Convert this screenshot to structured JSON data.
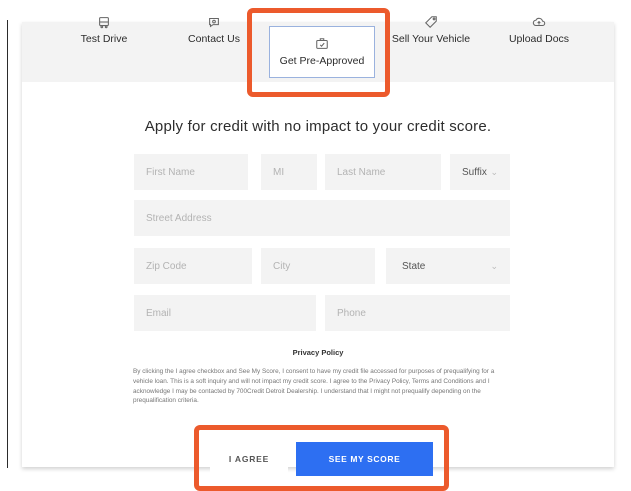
{
  "tabs": [
    {
      "label": "Test Drive",
      "icon": "car-icon"
    },
    {
      "label": "Contact Us",
      "icon": "chat-icon"
    },
    {
      "label": "Get Pre-Approved",
      "icon": "approval-icon",
      "active": true
    },
    {
      "label": "Sell Your Vehicle",
      "icon": "tag-icon"
    },
    {
      "label": "Upload Docs",
      "icon": "upload-cloud-icon"
    }
  ],
  "headline": "Apply for credit with no impact to your credit score.",
  "form": {
    "first_name_placeholder": "First Name",
    "mi_placeholder": "MI",
    "last_name_placeholder": "Last Name",
    "suffix_label": "Suffix",
    "street_placeholder": "Street Address",
    "zip_placeholder": "Zip Code",
    "city_placeholder": "City",
    "state_label": "State",
    "email_placeholder": "Email",
    "phone_placeholder": "Phone"
  },
  "privacy": {
    "title": "Privacy Policy",
    "text": "By clicking the I agree checkbox and See My Score, I consent to have my credit file accessed for purposes of prequalifying for a vehicle loan. This is a soft inquiry and will not impact my credit score. I agree to the Privacy Policy, Terms and Conditions and I acknowledge I may be contacted by 700Credit Detroit Dealership. I understand that I might not prequalify depending on the prequalification criteria."
  },
  "actions": {
    "agree_label": "I AGREE",
    "see_score_label": "SEE MY SCORE"
  },
  "colors": {
    "highlight": "#ec5a2c",
    "primary_button": "#2d6ff2",
    "field_bg": "#f3f3f3"
  }
}
